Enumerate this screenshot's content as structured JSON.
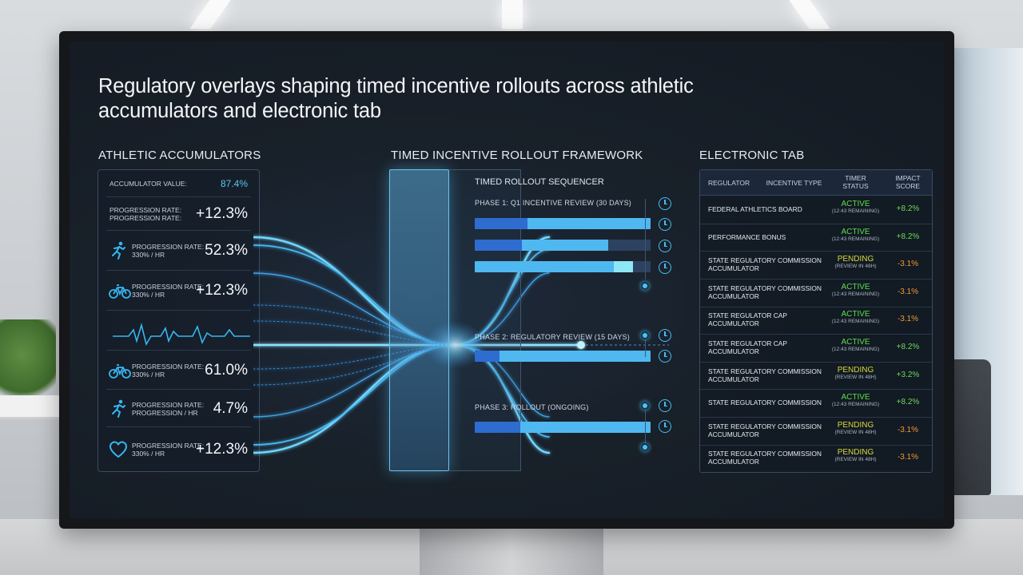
{
  "title": "Regulatory overlays shaping timed incentive rollouts across athletic accumulators and electronic tab",
  "left": {
    "heading": "ATHLETIC ACCUMULATORS",
    "rows": [
      {
        "label": "ACCUMULATOR VALUE:",
        "value": "87.4%",
        "icon": ""
      },
      {
        "label": "PROGRESSION RATE:\nPROGRESSION RATE:",
        "value": "+12.3%",
        "icon": ""
      },
      {
        "label": "PROGRESSION RATE:\n330% / HR",
        "value": "52.3%",
        "icon": "runner-icon"
      },
      {
        "label": "PROGRESSION RATE:\n330% / HR",
        "value": "+12.3%",
        "icon": "bicycle-icon"
      },
      {
        "label": "",
        "value": "",
        "icon": "heartbeat-pulse-icon"
      },
      {
        "label": "PROGRESSION RATE:\n330% / HR",
        "value": "61.0%",
        "icon": "bicycle-icon"
      },
      {
        "label": "PROGRESSION RATE:\nPROGRESSION / HR",
        "value": "4.7%",
        "icon": "runner-icon"
      },
      {
        "label": "PROGRESSION RATE:\n330% / HR",
        "value": "+12.3%",
        "icon": "heart-icon"
      }
    ]
  },
  "center": {
    "heading": "TIMED INCENTIVE ROLLOUT FRAMEWORK",
    "sequencer_title": "TIMED ROLLOUT SEQUENCER",
    "phases": [
      {
        "label": "PHASE 1: Q1 INCENTIVE REVIEW (30 DAYS)"
      },
      {
        "label": "PHASE 2: REGULATORY REVIEW (15 DAYS)"
      },
      {
        "label": "PHASE 3: ROLLOUT (ONGOING)"
      }
    ],
    "bars": [
      {
        "segments": [
          0.3,
          1.0
        ]
      },
      {
        "segments": [
          0.27,
          0.76
        ]
      },
      {
        "segments": [
          0.0,
          0.79,
          0.9
        ]
      },
      {
        "segments": [
          0.14,
          1.0
        ]
      },
      {
        "segments": [
          0.26,
          1.0
        ]
      }
    ]
  },
  "right": {
    "heading": "ELECTRONIC TAB",
    "columns": [
      "REGULATOR",
      "INCENTIVE TYPE",
      "TIMER\nSTATUS",
      "IMPACT\nSCORE"
    ],
    "rows": [
      {
        "regulator": "FEDERAL ATHLETICS BOARD",
        "status": "ACTIVE",
        "sub": "(12:43 REMAINING)",
        "score": "+8.2%"
      },
      {
        "regulator": "PERFORMANCE BONUS",
        "status": "ACTIVE",
        "sub": "(12:43 REMAINING)",
        "score": "+8.2%"
      },
      {
        "regulator": "STATE REGULATORY COMMISSION\nACCUMULATOR",
        "status": "PENDING",
        "sub": "(REVIEW IN 48H)",
        "score": "-3.1%"
      },
      {
        "regulator": "STATE REGULATORY COMMISSION\nACCUMULATOR",
        "status": "ACTIVE",
        "sub": "(12:43 REMAINING)",
        "score": "-3.1%"
      },
      {
        "regulator": "STATE REGULATOR CAP\nACCUMULATOR",
        "status": "ACTIVE",
        "sub": "(12:43 REMAINING)",
        "score": "-3.1%"
      },
      {
        "regulator": "STATE REGULATOR CAP\nACCUMULATOR",
        "status": "ACTIVE",
        "sub": "(12:43 REMAINING)",
        "score": "+8.2%"
      },
      {
        "regulator": "STATE REGULATORY COMMISSION\nACCUMULATOR",
        "status": "PENDING",
        "sub": "(REVIEW IN 48H)",
        "score": "+3.2%"
      },
      {
        "regulator": "STATE REGULATORY COMMISSION",
        "status": "ACTIVE",
        "sub": "(12:43 REMAINING)",
        "score": "+8.2%"
      },
      {
        "regulator": "STATE REGULATORY COMMISSION\nACCUMULATOR",
        "status": "PENDING",
        "sub": "(REVIEW IN 48H)",
        "score": "-3.1%"
      },
      {
        "regulator": "STATE REGULATORY COMMISSION\nACCUMULATOR",
        "status": "PENDING",
        "sub": "(REVIEW IN 48H)",
        "score": "-3.1%"
      }
    ]
  },
  "colors": {
    "accent": "#4fb8f0",
    "active": "#5fdc52",
    "pending": "#d6d83c",
    "positive": "#6fd85a",
    "negative": "#ee9a36"
  }
}
